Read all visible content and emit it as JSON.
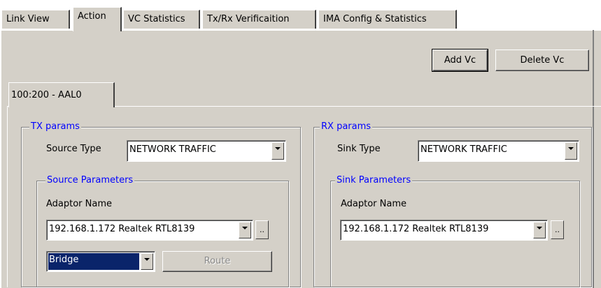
{
  "tabs": [
    {
      "label": "Link View"
    },
    {
      "label": "Action"
    },
    {
      "label": "VC Statistics"
    },
    {
      "label": "Tx/Rx Verificaition"
    },
    {
      "label": "IMA Config & Statistics"
    }
  ],
  "active_tab": "Action",
  "toolbar": {
    "add_vc": "Add Vc",
    "delete_vc": "Delete Vc"
  },
  "vc_tab": {
    "label": "100:200 - AAL0"
  },
  "tx": {
    "title": "TX params",
    "source_type_label": "Source Type",
    "source_type_value": "NETWORK TRAFFIC",
    "source_params_title": "Source Parameters",
    "adaptor_label": "Adaptor Name",
    "adaptor_value": "192.168.1.172  Realtek RTL8139",
    "browse_label": "..",
    "mode_value": "Bridge",
    "route_label": "Route"
  },
  "rx": {
    "title": "RX params",
    "sink_type_label": "Sink Type",
    "sink_type_value": "NETWORK TRAFFIC",
    "sink_params_title": "Sink Parameters",
    "adaptor_label": "Adaptor Name",
    "adaptor_value": "192.168.1.172  Realtek RTL8139",
    "browse_label": ".."
  },
  "colors": {
    "face": "#d4d0c8",
    "legend": "#0000ff",
    "selection": "#0a246a"
  }
}
